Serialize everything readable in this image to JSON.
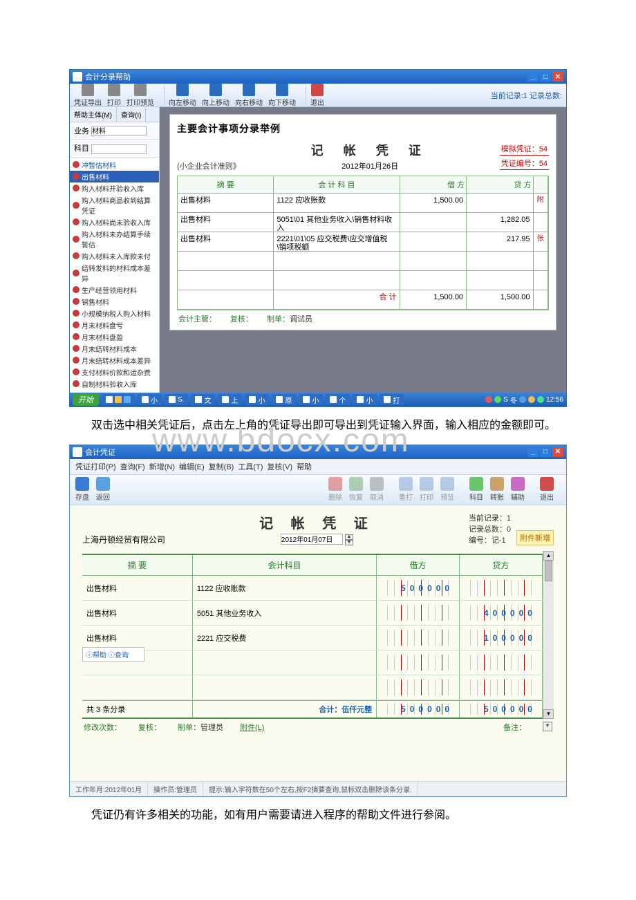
{
  "watermark": "www.bdocx.com",
  "win1": {
    "title": "会计分录帮助",
    "toolbar": {
      "export": "凭证导出",
      "print": "打印",
      "preview": "打印预览",
      "moveleft": "向左移动",
      "moveup": "向上移动",
      "moveright": "向右移动",
      "movedown": "向下移动",
      "exit": "退出",
      "status": "当前记录:1 记录总数:"
    },
    "tabs": {
      "a": "帮助主体(M)",
      "b": "查询(I)"
    },
    "form": {
      "biz": "业务",
      "bizval": "材料",
      "subj": "科目"
    },
    "tree": [
      "冲暂估材料",
      "出售材料",
      "购入材料开验收入库",
      "购入材料商品收到结算凭证",
      "购入材料尚未验收入库",
      "购入材料未办结算手续暂估",
      "购入材料未入库款未付",
      "结转发料的材料成本差异",
      "生产经营领用材料",
      "销售材料",
      "小规模纳税人购入材料",
      "月末材料盘亏",
      "月末材料盘盈",
      "月末结转材料成本",
      "月末结转材料成本差异",
      "支付材料价款和运杂费",
      "自制材料验收入库"
    ],
    "tree_sel_index": 1,
    "voucher": {
      "bigtitle": "主要会计事项分录举例",
      "rule": "(小企业会计准则》",
      "head": "记   帐   凭   证",
      "date": "2012年01月26日",
      "mock": "模拟凭证：",
      "mockno": "54",
      "vno": "凭证编号：",
      "vnoval": "54",
      "cols": {
        "c1": "摘 要",
        "c2": "会 计 科 目",
        "c3": "借 方",
        "c4": "贷 方"
      },
      "rows": [
        {
          "a": "出售材料",
          "b": "1122 应收账款",
          "d": "1,500.00",
          "c": ""
        },
        {
          "a": "出售材料",
          "b": "5051\\01 其他业务收入\\销售材料收入",
          "d": "",
          "c": "1,282.05"
        },
        {
          "a": "出售材料",
          "b": "2221\\01\\05 应交税费\\应交增值税\\销项税额",
          "d": "",
          "c": "217.95"
        }
      ],
      "side": {
        "a": "附",
        "b": "张"
      },
      "totallbl": "合 计",
      "totald": "1,500.00",
      "totalc": "1,500.00",
      "foot": {
        "a": "会计主管：",
        "b": "复核：",
        "c": "制单：",
        "cval": "调试员"
      }
    },
    "taskbar": {
      "start": "开始",
      "items": [
        "小",
        "S.",
        "文",
        "上",
        "小",
        "原",
        "小",
        "个",
        "小",
        "打"
      ],
      "time": "12:56"
    }
  },
  "para1": "双击选中相关凭证后，点击左上角的凭证导出即可导出到凭证输入界面，输入相应的金额即可。",
  "win2": {
    "title": "会计凭证",
    "menu": [
      "凭证打印(P)",
      "查询(F)",
      "新增(N)",
      "编辑(E)",
      "复制(B)",
      "工具(T)",
      "复核(V)",
      "帮助"
    ],
    "toolbar": {
      "save": "存盘",
      "back": "返回",
      "del": "删除",
      "rest": "恢复",
      "undo": "取消",
      "reprint": "重打",
      "print": "打印",
      "prev": "预览",
      "subj": "科目",
      "trans": "转账",
      "aux": "辅助",
      "exit": "退出"
    },
    "head": {
      "company": "上海丹顿经贸有限公司",
      "title": "记 帐 凭 证",
      "date": "2012年01月07日",
      "cur_lbl": "当前记录：",
      "cur_val": "1",
      "tot_lbl": "记录总数：",
      "tot_val": "0",
      "no_lbl": "编号：",
      "no_val": "记-1",
      "attach": "附件新增"
    },
    "grid": {
      "h1": "摘 要",
      "h2": "会计科目",
      "h3": "借方",
      "h4": "贷方",
      "rows": [
        {
          "a": "出售材料",
          "b": "1122 应收账款",
          "d": "500000",
          "c": ""
        },
        {
          "a": "出售材料",
          "b": "5051 其他业务收入",
          "d": "",
          "c": "400000"
        },
        {
          "a": "出售材料",
          "b": "2221 应交税费",
          "d": "",
          "c": "100000"
        }
      ],
      "helper": {
        "a": "帮助",
        "b": "查询"
      },
      "countlbl": "共 3 条分录",
      "totaltext": "合计：伍仟元整",
      "totald": "500000",
      "totalc": "500000"
    },
    "foot": {
      "mod": "修改次数：",
      "rev": "复核：",
      "maker": "制单：",
      "makerval": "管理员",
      "att": "附件(L)",
      "note": "备注："
    },
    "status": {
      "a": "工作年月:2012年01月",
      "b": "操作员:管理员",
      "c": "提示:输入字符数在50个左右,按F2摘要查询,鼠标双击删除该条分录."
    }
  },
  "para2": "凭证仍有许多相关的功能，如有用户需要请进入程序的帮助文件进行参阅。"
}
